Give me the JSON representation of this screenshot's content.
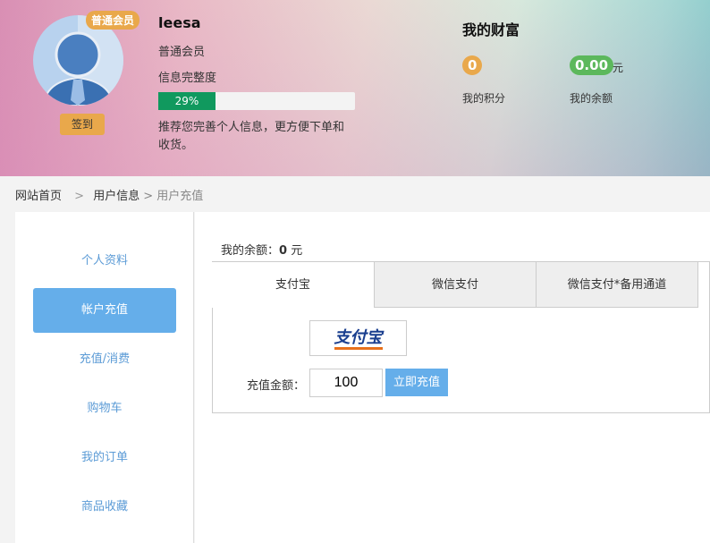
{
  "user": {
    "name": "leesa",
    "level_badge": "普通会员",
    "level": "普通会员",
    "completeness_label": "信息完整度",
    "completeness_percent": 29,
    "completeness_text": "29%",
    "tip": "推荐您完善个人信息，更方便下单和收货。",
    "sign_in": "签到"
  },
  "wealth": {
    "title": "我的财富",
    "points": "0",
    "points_label": "我的积分",
    "balance": "0.00",
    "balance_unit": "元",
    "balance_label": "我的余额"
  },
  "breadcrumb": {
    "home": "网站首页",
    "sep": ">",
    "user_info": "用户信息",
    "current": "> 用户充值"
  },
  "sidebar": {
    "items": [
      {
        "label": "个人资料"
      },
      {
        "label": "帐户充值"
      },
      {
        "label": "充值/消费"
      },
      {
        "label": "购物车"
      },
      {
        "label": "我的订单"
      },
      {
        "label": "商品收藏"
      }
    ]
  },
  "main": {
    "balance_label": "我的余额：",
    "balance_value": "0",
    "balance_unit": " 元",
    "tabs": [
      {
        "label": "支付宝"
      },
      {
        "label": "微信支付"
      },
      {
        "label": "微信支付*备用通道"
      }
    ],
    "logo_text": "支付宝",
    "amount_label": "充值金额：",
    "amount_value": "100",
    "submit": "立即充值"
  },
  "colors": {
    "accent": "#65aeea",
    "orange": "#e9a84b",
    "green": "#10995e",
    "pill_green": "#5cb85c"
  }
}
